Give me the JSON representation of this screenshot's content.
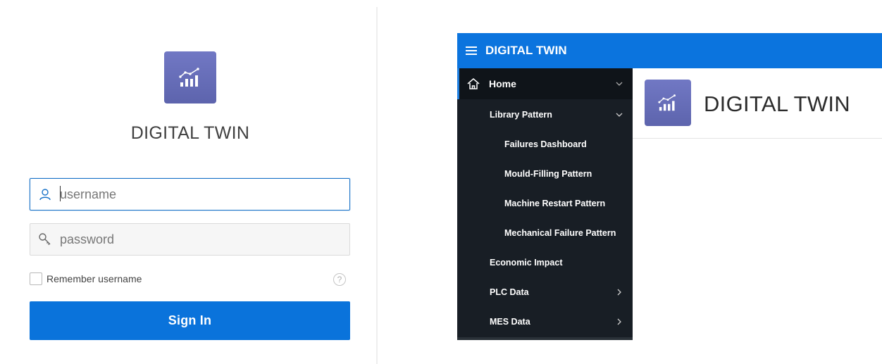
{
  "login": {
    "title": "DIGITAL TWIN",
    "logo_icon": "chart-trend-icon",
    "username_placeholder": "username",
    "password_placeholder": "password",
    "remember_label": "Remember username",
    "remember_checked": false,
    "help_glyph": "?",
    "signin_label": "Sign In"
  },
  "app": {
    "title": "DIGITAL TWIN",
    "content_title": "DIGITAL TWIN",
    "nav": [
      {
        "label": "Home",
        "icon": "home-icon",
        "expanded": true,
        "active": true
      },
      {
        "label": "Library Pattern",
        "expanded": true
      },
      {
        "label": "Failures Dashboard"
      },
      {
        "label": "Mould-Filling Pattern"
      },
      {
        "label": "Machine Restart Pattern"
      },
      {
        "label": "Mechanical Failure Pattern"
      },
      {
        "label": "Economic Impact"
      },
      {
        "label": "PLC Data",
        "expandable": true
      },
      {
        "label": "MES Data",
        "expandable": true
      }
    ]
  },
  "colors": {
    "accent": "#0b74de",
    "sidebar": "#181e25",
    "logo": "#676dba"
  }
}
